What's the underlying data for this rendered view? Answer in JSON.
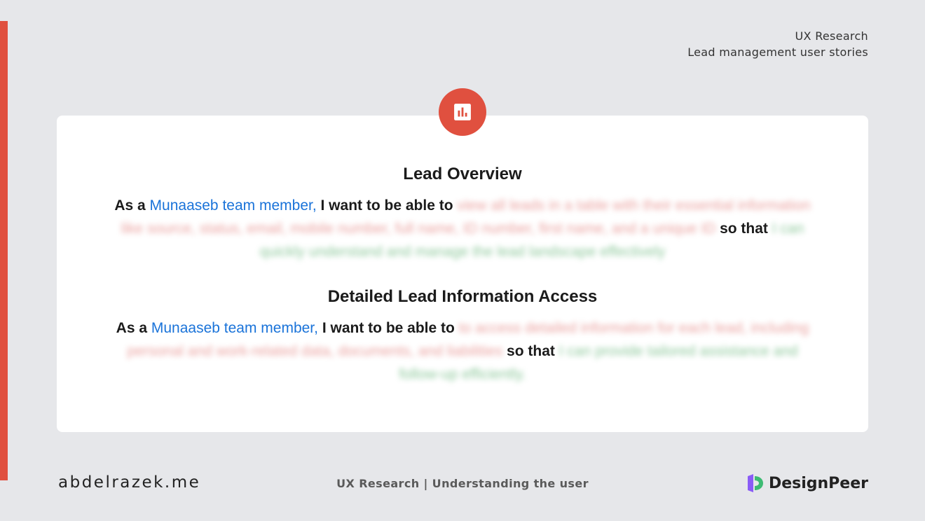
{
  "header": {
    "line1": "UX Research",
    "line2": "Lead management user stories"
  },
  "badge_icon": "bar-chart-icon",
  "colors": {
    "accent": "#e0503f",
    "role": "#1a73d9",
    "goal_blurred": "#d9534f",
    "benefit_blurred": "#2e9a48"
  },
  "stories": [
    {
      "title": "Lead Overview",
      "prefix": "As a",
      "role": "Munaaseb team member,",
      "want": "I want to be able to",
      "goal": "view all leads in a table with their essential information like source, status, email, mobile number, full name, ID number, first name, and a unique ID",
      "so_that": "so that",
      "benefit": "I can quickly understand and manage the lead landscape effectively"
    },
    {
      "title": "Detailed Lead Information Access",
      "prefix": "As a",
      "role": "Munaaseb team member,",
      "want": "I want to be able to",
      "goal": "to access detailed information for each lead, including personal and work-related data, documents, and liabilities",
      "so_that": "so that",
      "benefit": "I can provide tailored assistance and follow-up efficiently."
    }
  ],
  "footer": {
    "site": "abdelrazek.me",
    "center": "UX Research | Understanding the user",
    "brand": "DesignPeer",
    "brand_icon": "designpeer-logo-icon"
  }
}
